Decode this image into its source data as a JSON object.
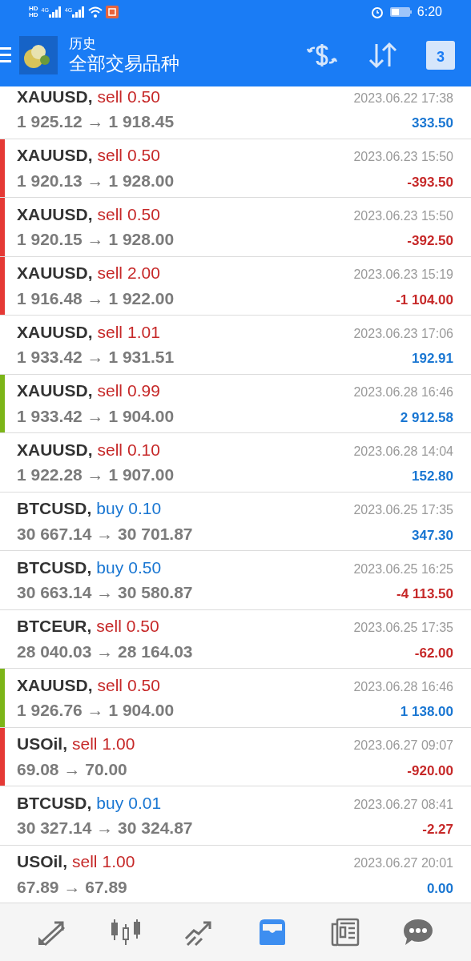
{
  "status_bar": {
    "network_labels": [
      "HD",
      "HD"
    ],
    "signal_labels": [
      "4G",
      "4G"
    ],
    "time": "6:20"
  },
  "header": {
    "title": "历史",
    "subtitle": "全部交易品种",
    "calendar_day": "3"
  },
  "deals": [
    {
      "symbol": "XAUUSD,",
      "type": "sell",
      "kind": "sell",
      "volume": "0.50",
      "prices": "1 925.12 → 1 918.45",
      "time": "2023.06.22 17:38",
      "profit": "333.50",
      "positive": true
    },
    {
      "symbol": "XAUUSD,",
      "type": "sell",
      "kind": "sell",
      "volume": "0.50",
      "prices": "1 920.13 → 1 928.00",
      "time": "2023.06.23 15:50",
      "profit": "-393.50",
      "positive": false,
      "color": "#e53935"
    },
    {
      "symbol": "XAUUSD,",
      "type": "sell",
      "kind": "sell",
      "volume": "0.50",
      "prices": "1 920.15 → 1 928.00",
      "time": "2023.06.23 15:50",
      "profit": "-392.50",
      "positive": false,
      "color": "#e53935"
    },
    {
      "symbol": "XAUUSD,",
      "type": "sell",
      "kind": "sell",
      "volume": "2.00",
      "prices": "1 916.48 → 1 922.00",
      "time": "2023.06.23 15:19",
      "profit": "-1 104.00",
      "positive": false,
      "color": "#e53935"
    },
    {
      "symbol": "XAUUSD,",
      "type": "sell",
      "kind": "sell",
      "volume": "1.01",
      "prices": "1 933.42 → 1 931.51",
      "time": "2023.06.23 17:06",
      "profit": "192.91",
      "positive": true
    },
    {
      "symbol": "XAUUSD,",
      "type": "sell",
      "kind": "sell",
      "volume": "0.99",
      "prices": "1 933.42 → 1 904.00",
      "time": "2023.06.28 16:46",
      "profit": "2 912.58",
      "positive": true,
      "color": "#7cb518"
    },
    {
      "symbol": "XAUUSD,",
      "type": "sell",
      "kind": "sell",
      "volume": "0.10",
      "prices": "1 922.28 → 1 907.00",
      "time": "2023.06.28 14:04",
      "profit": "152.80",
      "positive": true
    },
    {
      "symbol": "BTCUSD,",
      "type": "buy",
      "kind": "buy",
      "volume": "0.10",
      "prices": "30 667.14 → 30 701.87",
      "time": "2023.06.25 17:35",
      "profit": "347.30",
      "positive": true
    },
    {
      "symbol": "BTCUSD,",
      "type": "buy",
      "kind": "buy",
      "volume": "0.50",
      "prices": "30 663.14 → 30 580.87",
      "time": "2023.06.25 16:25",
      "profit": "-4 113.50",
      "positive": false
    },
    {
      "symbol": "BTCEUR,",
      "type": "sell",
      "kind": "sell",
      "volume": "0.50",
      "prices": "28 040.03 → 28 164.03",
      "time": "2023.06.25 17:35",
      "profit": "-62.00",
      "positive": false
    },
    {
      "symbol": "XAUUSD,",
      "type": "sell",
      "kind": "sell",
      "volume": "0.50",
      "prices": "1 926.76 → 1 904.00",
      "time": "2023.06.28 16:46",
      "profit": "1 138.00",
      "positive": true,
      "color": "#7cb518"
    },
    {
      "symbol": "USOil,",
      "type": "sell",
      "kind": "sell",
      "volume": "1.00",
      "prices": "69.08 → 70.00",
      "time": "2023.06.27 09:07",
      "profit": "-920.00",
      "positive": false,
      "color": "#e53935"
    },
    {
      "symbol": "BTCUSD,",
      "type": "buy",
      "kind": "buy",
      "volume": "0.01",
      "prices": "30 327.14 → 30 324.87",
      "time": "2023.06.27 08:41",
      "profit": "-2.27",
      "positive": false
    },
    {
      "symbol": "USOil,",
      "type": "sell",
      "kind": "sell",
      "volume": "1.00",
      "prices": "67.89 → 67.89",
      "time": "2023.06.27 20:01",
      "profit": "0.00",
      "positive": true
    }
  ],
  "bottom_nav": [
    {
      "kind": "trade",
      "selected": false
    },
    {
      "kind": "chart",
      "selected": false
    },
    {
      "kind": "quotes",
      "selected": false
    },
    {
      "kind": "history",
      "selected": true
    },
    {
      "kind": "news",
      "selected": false
    },
    {
      "kind": "chat",
      "selected": false
    }
  ]
}
